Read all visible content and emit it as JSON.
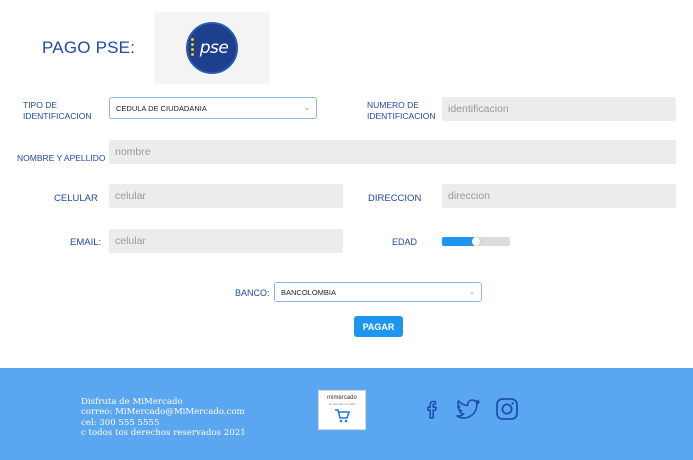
{
  "page": {
    "title": "PAGO PSE:",
    "logo_text": "pse"
  },
  "form": {
    "tipo_label": "TIPO DE IDENTIFICACION",
    "tipo_label_1": "TIPO DE",
    "tipo_label_2": "IDENTIFICACION",
    "tipo_value": "CEDULA DE CIUDADANIA",
    "numero_label_1": "NUMERO DE",
    "numero_label_2": "IDENTIFICACION",
    "numero_placeholder": "identificacion",
    "nombre_label": "NOMBRE Y APELLIDO",
    "nombre_placeholder": "nombre",
    "celular_label": "CELULAR",
    "celular_placeholder": "celular",
    "direccion_label": "DIRECCION",
    "direccion_placeholder": "direccion",
    "email_label": "EMAIL:",
    "email_placeholder": "celular",
    "edad_label": "EDAD",
    "edad_level": 0.5,
    "banco_label": "BANCO:",
    "banco_value": "BANCOLOMBIA",
    "submit_label": "PAGAR"
  },
  "footer": {
    "line1": "Disfruta de MiMercado",
    "line2": "correo: MiMercado@MiMercado.com",
    "line3": "cel: 300 555 5555",
    "line4": " c todos tos derechos reservados 2021",
    "logo_title": "mimercado",
    "logo_sub": "tu mercado en casa",
    "social_icons": [
      "facebook-icon",
      "twitter-icon",
      "instagram-icon"
    ]
  },
  "colors": {
    "accent": "#1e96f0",
    "label": "#1f4aa8",
    "footer_bg": "#5aa6f0",
    "field_bg": "#ececec"
  }
}
